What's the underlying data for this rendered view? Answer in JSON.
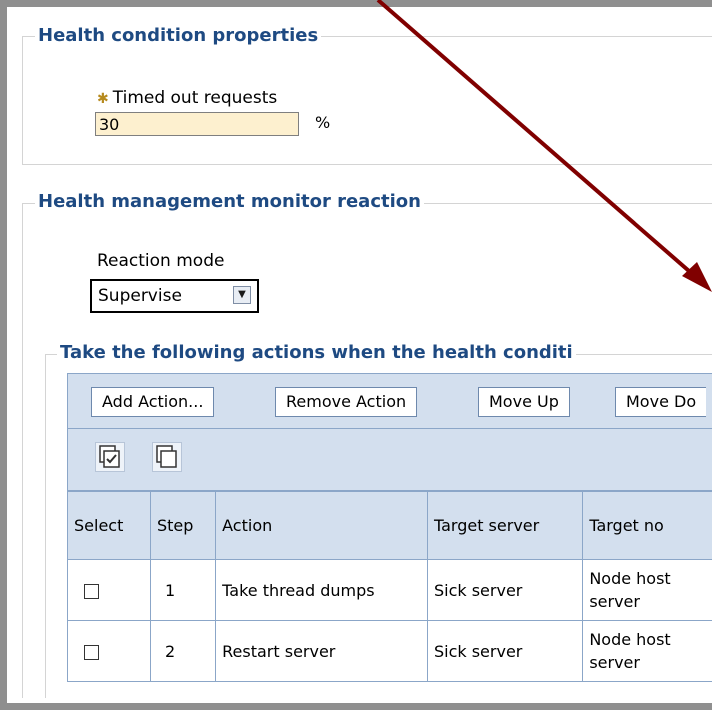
{
  "health_condition": {
    "legend": "Health condition properties",
    "field_label": "Timed out requests",
    "field_value": "30",
    "unit": "%"
  },
  "monitor_reaction": {
    "legend": "Health management monitor reaction",
    "mode_label": "Reaction mode",
    "mode_value": "Supervise"
  },
  "actions": {
    "legend": "Take the following actions when the health conditi",
    "buttons": {
      "add": "Add Action...",
      "remove": "Remove Action",
      "up": "Move Up",
      "down": "Move Do"
    },
    "icons": [
      "select-all-icon",
      "deselect-all-icon"
    ],
    "columns": [
      "Select",
      "Step",
      "Action",
      "Target server",
      "Target no"
    ],
    "rows": [
      {
        "step": "1",
        "action": "Take thread dumps",
        "target_server": "Sick server",
        "target_node": "Node host server"
      },
      {
        "step": "2",
        "action": "Restart server",
        "target_server": "Sick server",
        "target_node": "Node host server"
      }
    ]
  },
  "colors": {
    "legend": "#1e4a82",
    "header_bg": "#d3dfee",
    "input_bg": "#fdf0cf",
    "annotation_arrow": "#800000"
  }
}
